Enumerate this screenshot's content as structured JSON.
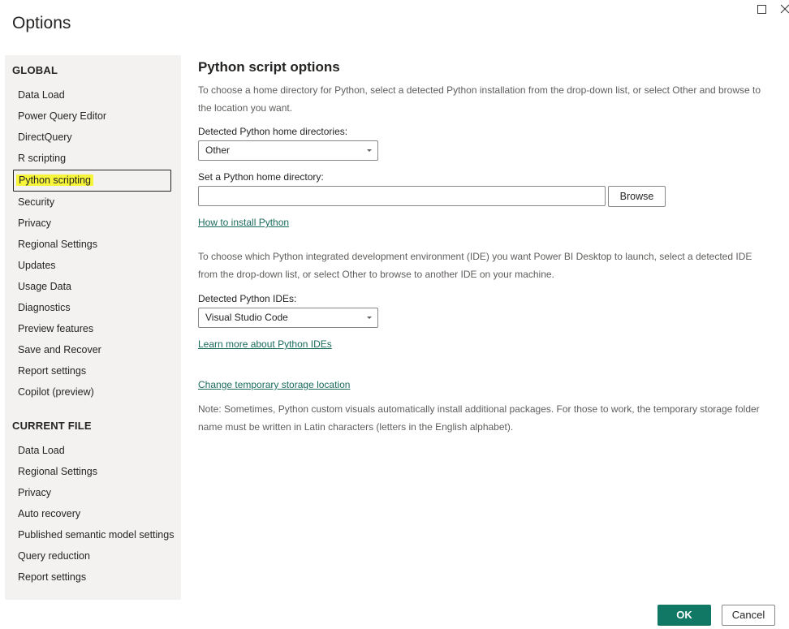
{
  "window": {
    "title": "Options",
    "maximize_icon": "maximize-icon",
    "close_icon": "close-icon"
  },
  "sidebar": {
    "global_heading": "GLOBAL",
    "global_items": [
      {
        "label": "Data Load"
      },
      {
        "label": "Power Query Editor"
      },
      {
        "label": "DirectQuery"
      },
      {
        "label": "R scripting"
      },
      {
        "label": "Python scripting",
        "selected": true
      },
      {
        "label": "Security"
      },
      {
        "label": "Privacy"
      },
      {
        "label": "Regional Settings"
      },
      {
        "label": "Updates"
      },
      {
        "label": "Usage Data"
      },
      {
        "label": "Diagnostics"
      },
      {
        "label": "Preview features"
      },
      {
        "label": "Save and Recover"
      },
      {
        "label": "Report settings"
      },
      {
        "label": "Copilot (preview)"
      }
    ],
    "current_heading": "CURRENT FILE",
    "current_items": [
      {
        "label": "Data Load"
      },
      {
        "label": "Regional Settings"
      },
      {
        "label": "Privacy"
      },
      {
        "label": "Auto recovery"
      },
      {
        "label": "Published semantic model settings"
      },
      {
        "label": "Query reduction"
      },
      {
        "label": "Report settings"
      }
    ]
  },
  "main": {
    "title": "Python script options",
    "home_desc": "To choose a home directory for Python, select a detected Python installation from the drop-down list, or select Other and browse to the location you want.",
    "detected_home_label": "Detected Python home directories:",
    "detected_home_value": "Other",
    "set_home_label": "Set a Python home directory:",
    "set_home_value": "",
    "browse_label": "Browse",
    "install_link": "How to install Python",
    "ide_desc": "To choose which Python integrated development environment (IDE) you want Power BI Desktop to launch, select a detected IDE from the drop-down list, or select Other to browse to another IDE on your machine.",
    "detected_ide_label": "Detected Python IDEs:",
    "detected_ide_value": "Visual Studio Code",
    "ide_link": "Learn more about Python IDEs",
    "storage_link": "Change temporary storage location",
    "note": "Note: Sometimes, Python custom visuals automatically install additional packages. For those to work, the temporary storage folder name must be written in Latin characters (letters in the English alphabet)."
  },
  "footer": {
    "ok_label": "OK",
    "cancel_label": "Cancel"
  },
  "colors": {
    "accent": "#117865",
    "link": "#1b6b5d",
    "highlight": "#f6f53a",
    "sidebar_bg": "#f3f2f1"
  }
}
